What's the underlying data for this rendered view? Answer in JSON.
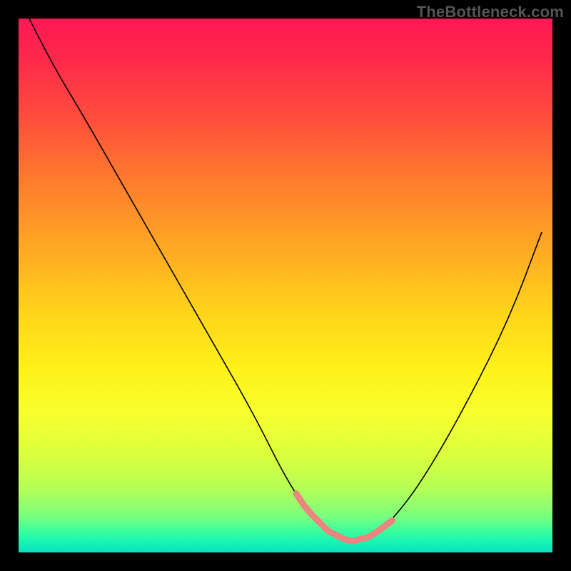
{
  "watermark": "TheBottleneck.com",
  "chart_data": {
    "type": "line",
    "title": "",
    "xlabel": "",
    "ylabel": "",
    "xlim": [
      0,
      100
    ],
    "ylim": [
      0,
      100
    ],
    "grid": false,
    "legend": false,
    "series": [
      {
        "name": "curve",
        "x": [
          2,
          6,
          12,
          20,
          28,
          36,
          44,
          50,
          54,
          58,
          62,
          66,
          70,
          76,
          84,
          92,
          98
        ],
        "y": [
          100,
          92,
          82,
          68,
          54,
          40,
          26,
          14,
          8,
          4,
          2,
          3,
          6,
          14,
          28,
          44,
          60
        ],
        "note": "V-shaped curve; y is height above the bottom edge (0 = bottom, 100 = top). Minimum near x≈62."
      }
    ],
    "marker": {
      "description": "pink rounded segment tracing the curve near its minimum",
      "x_range": [
        52,
        70
      ],
      "y_approx": 3,
      "color": "#e98680"
    },
    "background": {
      "type": "vertical-gradient",
      "stops": [
        {
          "pos": 0,
          "color": "#ff1855"
        },
        {
          "pos": 50,
          "color": "#ffd41a"
        },
        {
          "pos": 100,
          "color": "#0ae0c0"
        }
      ]
    }
  }
}
